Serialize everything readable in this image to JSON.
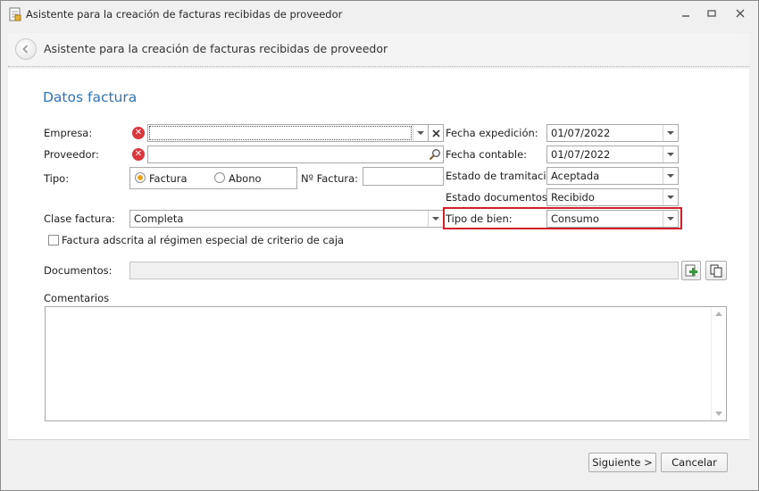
{
  "window": {
    "title": "Asistente para la creación de facturas recibidas de proveedor",
    "controls": [
      "minimize-icon",
      "restore-icon",
      "close-icon"
    ]
  },
  "header": {
    "title": "Asistente para la creación de facturas recibidas de proveedor"
  },
  "section": {
    "title": "Datos factura"
  },
  "form": {
    "empresa": {
      "label": "Empresa:",
      "value": ""
    },
    "proveedor": {
      "label": "Proveedor:",
      "value": ""
    },
    "tipo": {
      "label": "Tipo:",
      "options": [
        "Factura",
        "Abono"
      ],
      "selected": "Factura"
    },
    "num_factura": {
      "label": "Nº Factura:",
      "value": ""
    },
    "clase_factura": {
      "label": "Clase factura:",
      "value": "Completa"
    },
    "criterio_caja": {
      "label": "Factura adscrita al régimen especial de criterio de caja",
      "checked": false
    },
    "fecha_expedicion": {
      "label": "Fecha expedición:",
      "value": "01/07/2022"
    },
    "fecha_contable": {
      "label": "Fecha contable:",
      "value": "01/07/2022"
    },
    "estado_tramitacion": {
      "label": "Estado de tramitación:",
      "value": "Aceptada"
    },
    "estado_documentos": {
      "label": "Estado documentos:",
      "value": "Recibido"
    },
    "tipo_bien": {
      "label": "Tipo de bien:",
      "value": "Consumo"
    },
    "documentos": {
      "label": "Documentos:",
      "value": ""
    },
    "comentarios": {
      "label": "Comentarios",
      "value": ""
    }
  },
  "footer": {
    "next_label": "Siguiente >",
    "cancel_label": "Cancelar"
  },
  "colors": {
    "accent": "#2e74b5",
    "error": "#d9363e",
    "highlight_border": "#d0202a"
  }
}
